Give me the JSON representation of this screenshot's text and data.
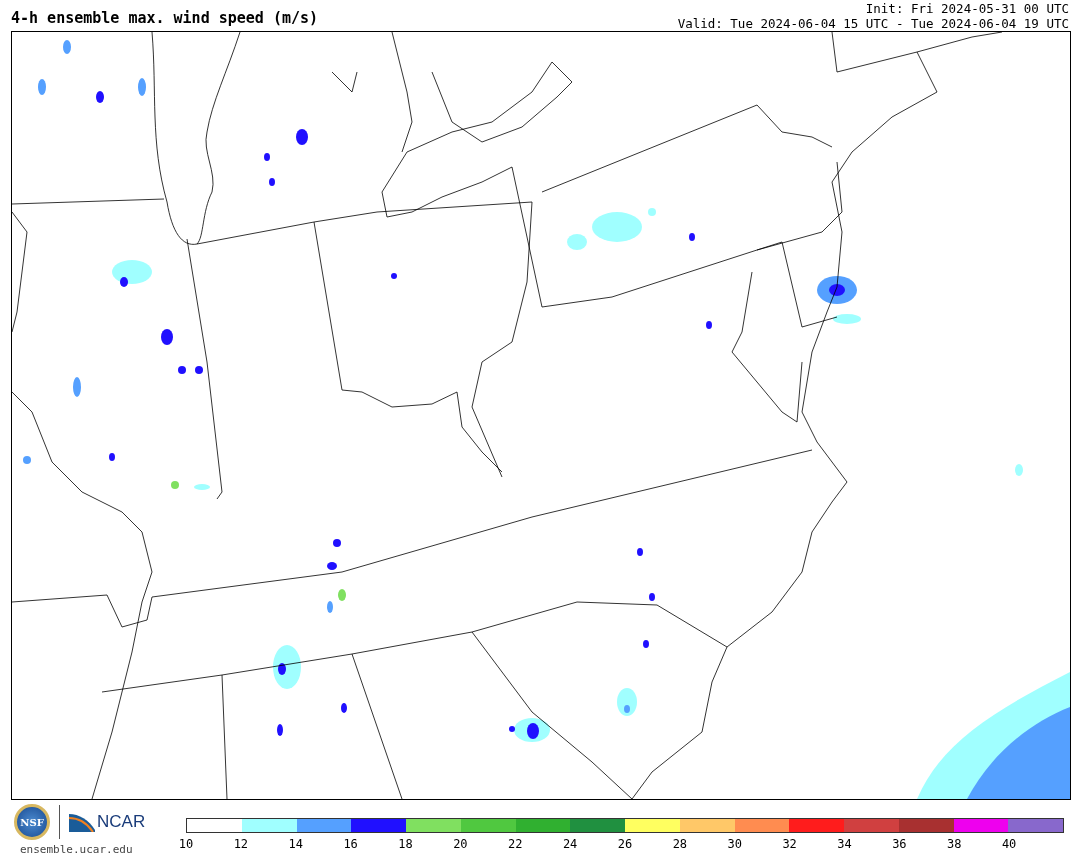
{
  "title": "4-h ensemble max. wind speed (m/s)",
  "init": "Init: Fri 2024-05-31 00 UTC",
  "valid": "Valid: Tue 2024-06-04 15 UTC - Tue 2024-06-04 19 UTC",
  "logos": {
    "nsf": "NSF",
    "ncar": "NCAR",
    "site": "ensemble.ucar.edu"
  },
  "colorbar": {
    "bins": [
      {
        "color": "#ffffff"
      },
      {
        "color": "#a0ffff"
      },
      {
        "color": "#55a0ff"
      },
      {
        "color": "#2010ff"
      },
      {
        "color": "#80e060"
      },
      {
        "color": "#50c840"
      },
      {
        "color": "#30b030"
      },
      {
        "color": "#209040"
      },
      {
        "color": "#ffff60"
      },
      {
        "color": "#ffc868"
      },
      {
        "color": "#ff8c50"
      },
      {
        "color": "#ff1c1c"
      },
      {
        "color": "#d04040"
      },
      {
        "color": "#a83030"
      },
      {
        "color": "#ee00ee"
      },
      {
        "color": "#8868cc"
      }
    ],
    "ticks": [
      "10",
      "12",
      "14",
      "16",
      "18",
      "20",
      "22",
      "24",
      "26",
      "28",
      "30",
      "32",
      "34",
      "36",
      "38",
      "40"
    ]
  }
}
